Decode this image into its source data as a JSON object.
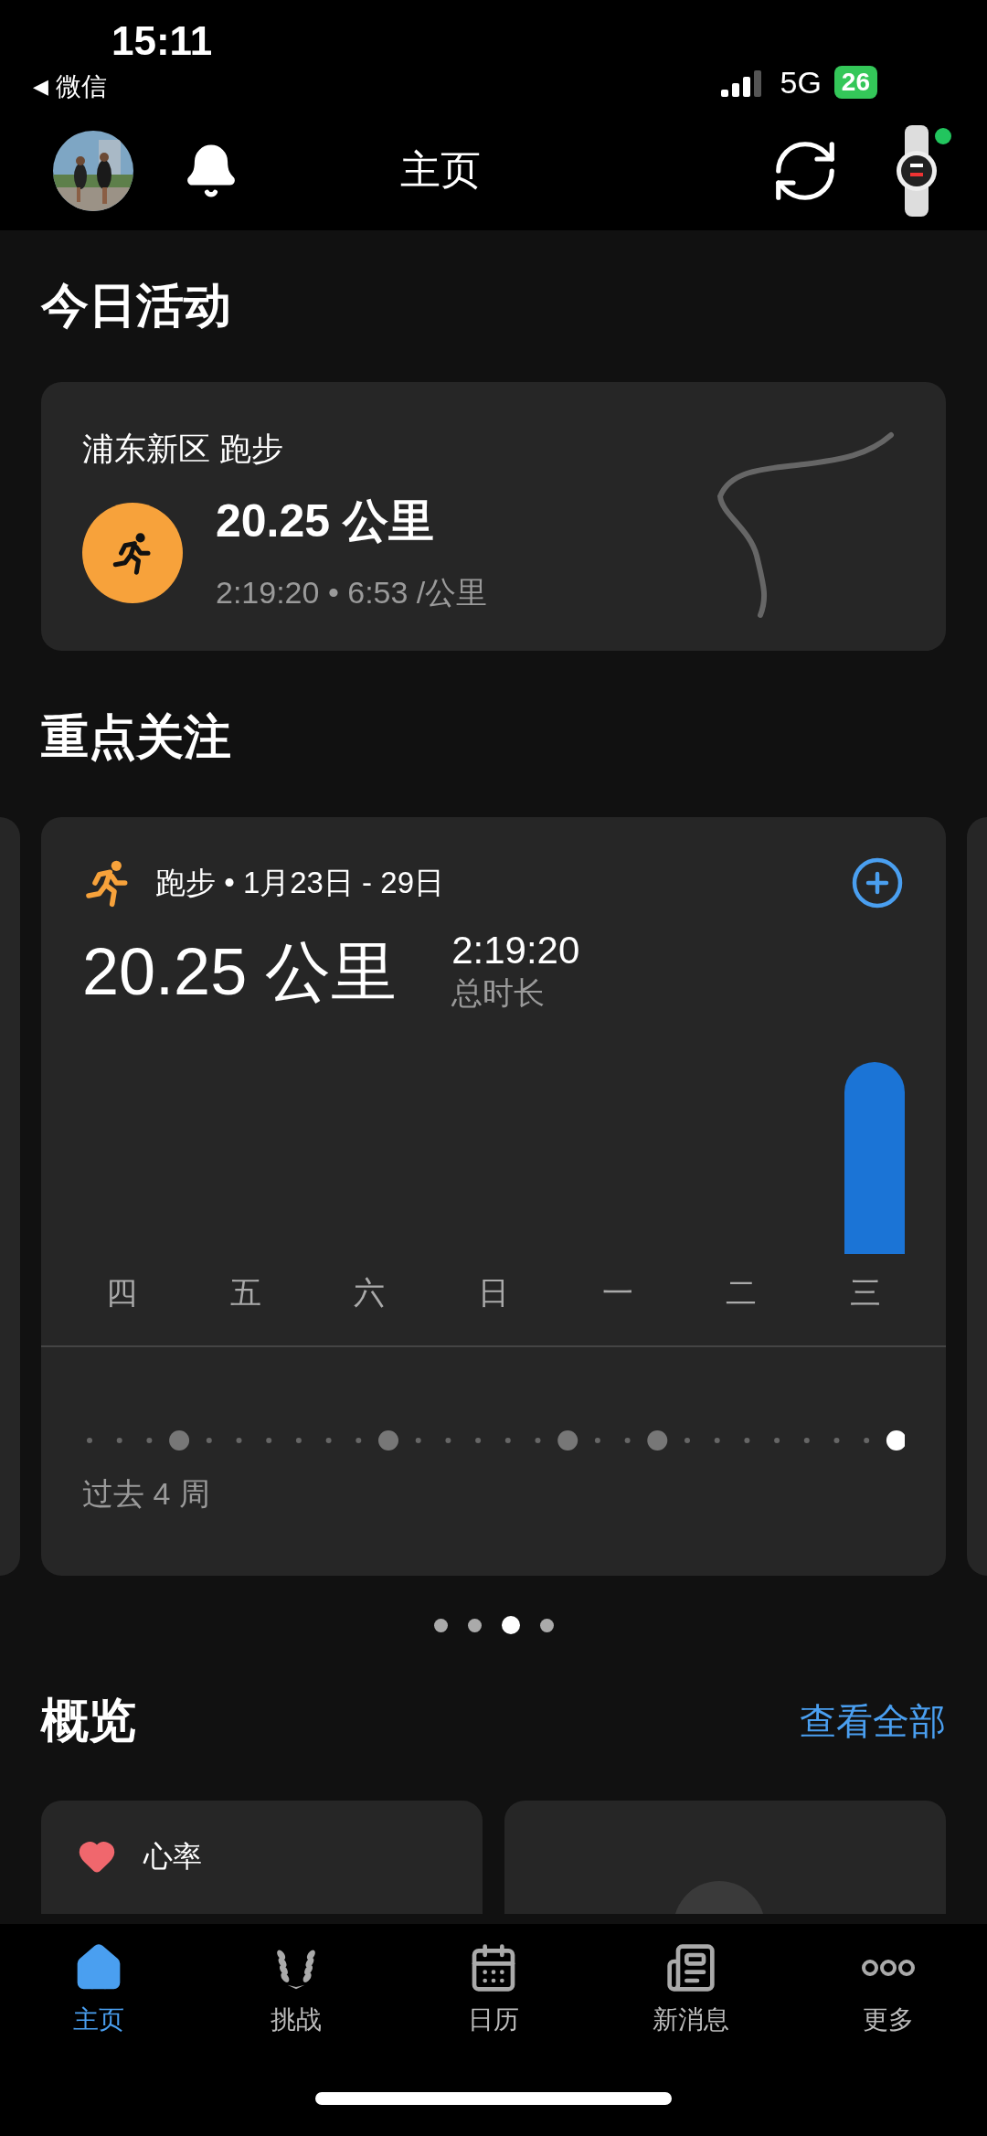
{
  "status_bar": {
    "time": "15:11",
    "back_arrow": "◀",
    "back_label": "微信",
    "network": "5G",
    "battery": "26"
  },
  "header": {
    "title": "主页"
  },
  "today": {
    "heading": "今日活动",
    "activity": {
      "title": "浦东新区 跑步",
      "distance": "20.25 公里",
      "details": "2:19:20 • 6:53 /公里"
    }
  },
  "focus": {
    "heading": "重点关注",
    "card": {
      "title": "跑步 • 1月23日 - 29日",
      "distance": "20.25 公里",
      "duration": "2:19:20",
      "duration_label": "总时长",
      "days": [
        "四",
        "五",
        "六",
        "日",
        "一",
        "二",
        "三"
      ],
      "period": "过去 4 周"
    },
    "pages": [
      {
        "selected": false
      },
      {
        "selected": false
      },
      {
        "selected": true
      },
      {
        "selected": false
      }
    ]
  },
  "overview": {
    "heading": "概览",
    "link": "查看全部",
    "cards": [
      {
        "kind": "metric",
        "label": "心率"
      },
      {
        "kind": "placeholder"
      }
    ]
  },
  "tabs": [
    {
      "kind": "home",
      "label": "主页",
      "selected": true
    },
    {
      "kind": "challenge",
      "label": "挑战",
      "selected": false
    },
    {
      "kind": "calendar",
      "label": "日历",
      "selected": false
    },
    {
      "kind": "news",
      "label": "新消息",
      "selected": false
    },
    {
      "kind": "more",
      "label": "更多",
      "selected": false
    }
  ]
}
